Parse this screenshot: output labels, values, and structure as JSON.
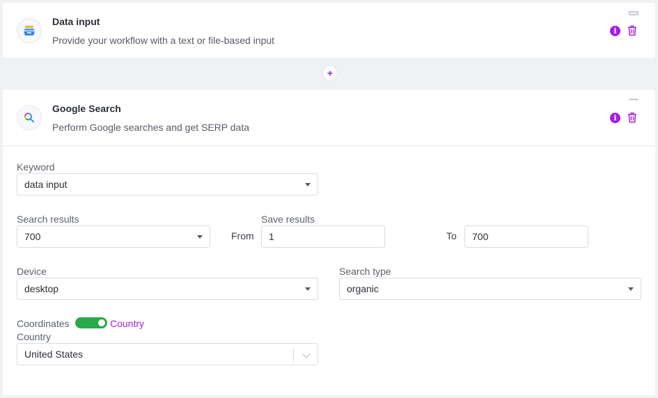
{
  "nodes": [
    {
      "title": "Data input",
      "description": "Provide your workflow with a text or file-based input",
      "icon": "data-input-icon"
    },
    {
      "title": "Google Search",
      "description": "Perform Google searches and get SERP data",
      "icon": "google-search-icon"
    }
  ],
  "add_step_symbol": "+",
  "info_symbol": "i",
  "form": {
    "keyword": {
      "label": "Keyword",
      "value": "data input"
    },
    "search_results": {
      "label": "Search results",
      "value": "700"
    },
    "save_results": {
      "label": "Save results",
      "from_label": "From",
      "from_value": "1",
      "to_label": "To",
      "to_value": "700"
    },
    "device": {
      "label": "Device",
      "value": "desktop"
    },
    "search_type": {
      "label": "Search type",
      "value": "organic"
    },
    "location_toggle": {
      "off_label": "Coordinates",
      "on_label": "Country",
      "state": "Country"
    },
    "country": {
      "label": "Country",
      "value": "United States"
    }
  },
  "colors": {
    "accent": "#a11ee6",
    "toggle_on": "#2aa84a",
    "background": "#f0f1f3"
  }
}
